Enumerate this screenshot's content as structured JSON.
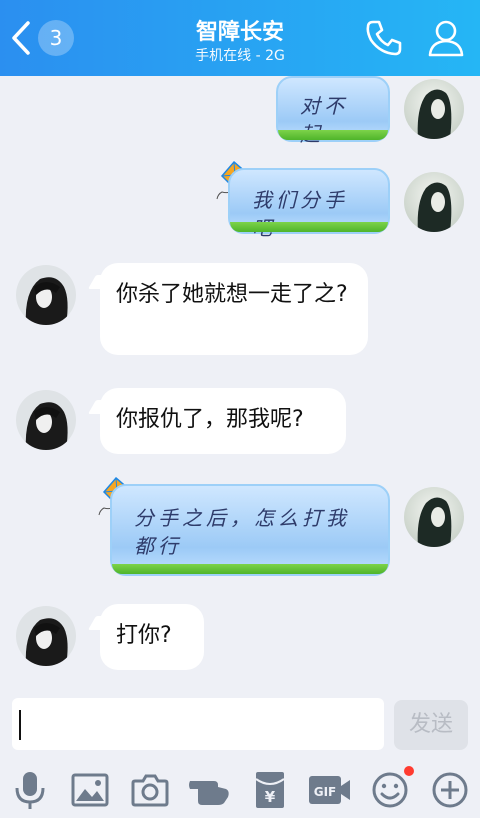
{
  "header": {
    "badge_count": "3",
    "title": "智障长安",
    "subtitle": "手机在线 - 2G"
  },
  "messages": [
    {
      "text": "对不起"
    },
    {
      "text": "我们分手吧"
    },
    {
      "text": "你杀了她就想一走了之?"
    },
    {
      "text": "你报仇了，那我呢?"
    },
    {
      "text": "分手之后，怎么打我都行"
    },
    {
      "text": "打你?"
    }
  ],
  "composer": {
    "send_label": "发送"
  },
  "toolbar": {
    "icons": [
      "microphone-icon",
      "image-icon",
      "camera-icon",
      "poke-icon",
      "red-packet-icon",
      "gif-icon",
      "emoji-icon",
      "plus-icon"
    ],
    "gif_label": "GIF",
    "yen_label": "¥"
  },
  "colors": {
    "header_start": "#2b8ff0",
    "header_end": "#25b6f5",
    "background": "#eef0f6",
    "notification_dot": "#ff3b30"
  }
}
